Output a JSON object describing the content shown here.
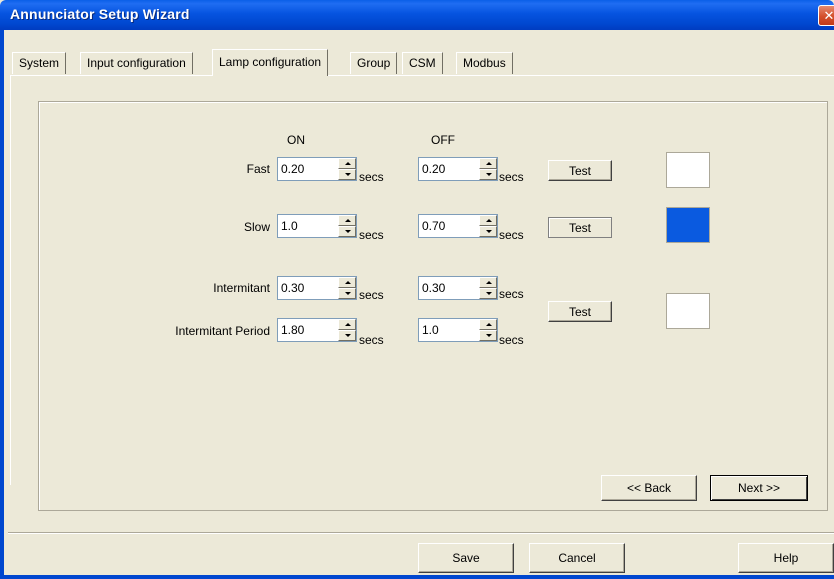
{
  "window": {
    "title": "Annunciator Setup Wizard",
    "close_glyph": "✕"
  },
  "tabs": [
    {
      "label": "System"
    },
    {
      "label": "Input configuration"
    },
    {
      "label": "Lamp configuration"
    },
    {
      "label": "Group"
    },
    {
      "label": "CSM"
    },
    {
      "label": "Modbus"
    }
  ],
  "active_tab": "Lamp configuration",
  "columns": {
    "on": "ON",
    "off": "OFF"
  },
  "units": "secs",
  "rows": {
    "fast": {
      "label": "Fast",
      "on": "0.20",
      "off": "0.20"
    },
    "slow": {
      "label": "Slow",
      "on": "1.0",
      "off": "0.70"
    },
    "intermittent": {
      "label": "Intermitant",
      "on": "0.30",
      "off": "0.30"
    },
    "intermittent_period": {
      "label": "Intermitant Period",
      "on": "1.80",
      "off": "1.0"
    }
  },
  "test_label": "Test",
  "swatches": {
    "fast": "#ffffff",
    "slow": "#0a5ae0",
    "intermittent": "#ffffff"
  },
  "nav": {
    "back": "<< Back",
    "next": "Next >>"
  },
  "footer": {
    "save": "Save",
    "cancel": "Cancel",
    "help": "Help"
  }
}
